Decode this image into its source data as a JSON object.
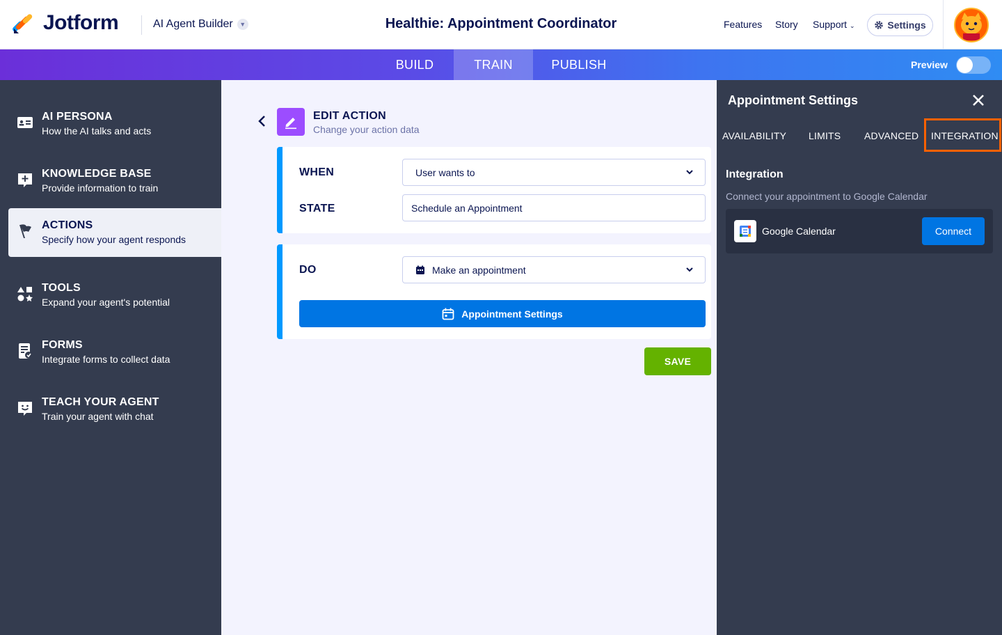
{
  "header": {
    "brand": "Jotform",
    "builder": "AI Agent Builder",
    "agent_title": "Healthie: Appointment Coordinator",
    "links": {
      "features": "Features",
      "story": "Story",
      "support": "Support"
    },
    "settings_label": "Settings"
  },
  "tabs": {
    "build": "BUILD",
    "train": "TRAIN",
    "publish": "PUBLISH",
    "active": "TRAIN"
  },
  "preview": {
    "label": "Preview",
    "enabled": false
  },
  "sidebar": {
    "items": [
      {
        "title": "AI PERSONA",
        "subtitle": "How the AI talks and acts",
        "icon": "id-card-icon"
      },
      {
        "title": "KNOWLEDGE BASE",
        "subtitle": "Provide information to train",
        "icon": "knowledge-plus-icon"
      },
      {
        "title": "ACTIONS",
        "subtitle": "Specify how your agent responds",
        "icon": "flag-icon"
      },
      {
        "title": "TOOLS",
        "subtitle": "Expand your agent's potential",
        "icon": "shapes-icon"
      },
      {
        "title": "FORMS",
        "subtitle": "Integrate forms to collect data",
        "icon": "form-icon"
      },
      {
        "title": "TEACH YOUR AGENT",
        "subtitle": "Train your agent with chat",
        "icon": "chat-smile-icon"
      }
    ],
    "active_index": 2
  },
  "edit": {
    "title": "EDIT ACTION",
    "subtitle": "Change your action data",
    "when_label": "WHEN",
    "when_value": "User wants to",
    "state_label": "STATE",
    "state_value": "Schedule an Appointment",
    "do_label": "DO",
    "do_value": "Make an appointment",
    "appt_button": "Appointment Settings",
    "save_button": "SAVE"
  },
  "panel": {
    "title": "Appointment Settings",
    "tabs": [
      "AVAILABILITY",
      "LIMITS",
      "ADVANCED",
      "INTEGRATION"
    ],
    "active_tab": "INTEGRATION",
    "section_title": "Integration",
    "section_desc": "Connect your appointment to Google Calendar",
    "integration_name": "Google Calendar",
    "connect_button": "Connect"
  },
  "colors": {
    "accent_blue": "#0075e3",
    "save_green": "#64b200",
    "sidebar_bg": "#343c4f",
    "highlight_orange": "#ff6100",
    "edit_icon_purple": "#9c4dff"
  }
}
